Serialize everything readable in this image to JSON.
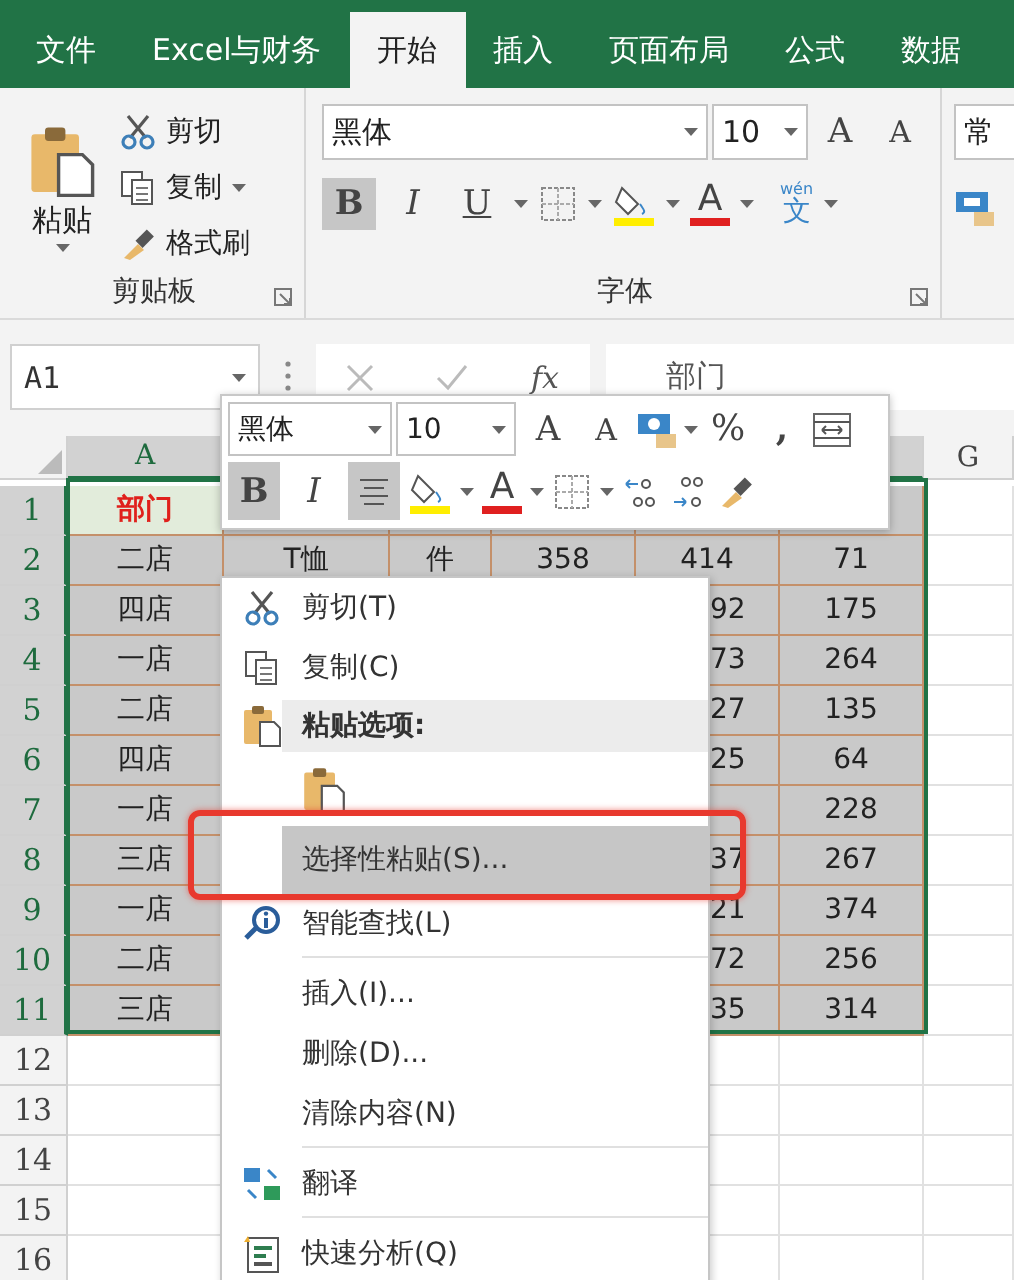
{
  "tabs": [
    {
      "label": "文件",
      "selected": false
    },
    {
      "label": "Excel与财务",
      "selected": false
    },
    {
      "label": "开始",
      "selected": true
    },
    {
      "label": "插入",
      "selected": false
    },
    {
      "label": "页面布局",
      "selected": false
    },
    {
      "label": "公式",
      "selected": false
    },
    {
      "label": "数据",
      "selected": false
    }
  ],
  "ribbon": {
    "clipboard": {
      "paste": "粘贴",
      "items": [
        {
          "label": "剪切",
          "dropdown": false
        },
        {
          "label": "复制",
          "dropdown": true
        },
        {
          "label": "格式刷",
          "dropdown": false
        }
      ],
      "label": "剪贴板"
    },
    "font": {
      "font_name": "黑体",
      "font_size": "10",
      "grow": "A",
      "shrink": "A",
      "styles": [
        {
          "label": "B",
          "on": true
        },
        {
          "label": "I",
          "on": false
        },
        {
          "label": "U",
          "on": false
        }
      ],
      "font_color": "A",
      "phonetic_top": "wén",
      "phonetic_main": "文",
      "label": "字体"
    },
    "number": {
      "format": "常"
    }
  },
  "formula_bar": {
    "name_box": "A1",
    "fx": "fx",
    "value": "部门"
  },
  "columns": [
    {
      "label": "A",
      "in_range": true
    },
    {
      "in_range": true
    },
    {
      "label": "G",
      "in_range": false
    }
  ],
  "rows": [
    {
      "header": "1",
      "in_range": true,
      "a": "部门",
      "title": true
    },
    {
      "header": "2",
      "in_range": true,
      "a": "二店",
      "b": "T恤",
      "c": "件",
      "d": "358",
      "e": "414",
      "f": "71"
    },
    {
      "header": "3",
      "in_range": true,
      "a": "四店",
      "e": "92",
      "e_cut": true,
      "f": "175"
    },
    {
      "header": "4",
      "in_range": true,
      "a": "一店",
      "e": "73",
      "e_cut": true,
      "f": "264"
    },
    {
      "header": "5",
      "in_range": true,
      "a": "二店",
      "e": "27",
      "e_cut": true,
      "f": "135"
    },
    {
      "header": "6",
      "in_range": true,
      "a": "四店",
      "e": "25",
      "e_cut": true,
      "f": "64"
    },
    {
      "header": "7",
      "in_range": true,
      "a": "一店",
      "f": "228"
    },
    {
      "header": "8",
      "in_range": true,
      "a": "三店",
      "e": "37",
      "e_cut": true,
      "f": "267"
    },
    {
      "header": "9",
      "in_range": true,
      "a": "一店",
      "e": "21",
      "e_cut": true,
      "f": "374"
    },
    {
      "header": "10",
      "in_range": true,
      "a": "二店",
      "e": "72",
      "e_cut": true,
      "f": "256"
    },
    {
      "header": "11",
      "in_range": true,
      "a": "三店",
      "e": "35",
      "e_cut": true,
      "f": "314"
    },
    {
      "header": "12",
      "in_range": false
    },
    {
      "header": "13",
      "in_range": false
    },
    {
      "header": "14",
      "in_range": false
    },
    {
      "header": "15",
      "in_range": false
    },
    {
      "header": "16",
      "in_range": false
    }
  ],
  "mini_toolbar": {
    "font_name": "黑体",
    "font_size": "10",
    "grow": "A",
    "shrink": "A",
    "percent": "%",
    "comma": ",",
    "bold": {
      "label": "B",
      "on": true
    },
    "italic": {
      "label": "I",
      "on": false
    },
    "center_on": true,
    "font_color": "A"
  },
  "context_menu": [
    {
      "kind": "command",
      "label": "剪切(T)",
      "selected": false
    },
    {
      "kind": "command",
      "label": "复制(C)",
      "selected": false
    },
    {
      "kind": "header",
      "label": "粘贴选项:"
    },
    {
      "kind": "paste_options"
    },
    {
      "kind": "command",
      "label": "选择性粘贴(S)...",
      "selected": true,
      "annotated": true
    },
    {
      "kind": "command",
      "label": "智能查找(L)",
      "selected": false
    },
    {
      "kind": "separator"
    },
    {
      "kind": "command",
      "label": "插入(I)...",
      "selected": false
    },
    {
      "kind": "command",
      "label": "删除(D)...",
      "selected": false
    },
    {
      "kind": "command",
      "label": "清除内容(N)",
      "selected": false
    },
    {
      "kind": "separator"
    },
    {
      "kind": "command",
      "label": "翻译",
      "selected": false
    },
    {
      "kind": "separator"
    },
    {
      "kind": "command",
      "label": "快速分析(Q)",
      "selected": false
    }
  ]
}
